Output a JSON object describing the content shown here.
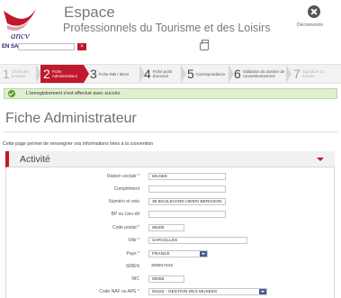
{
  "header": {
    "logo_text": "ancv",
    "brand_main": "Espace",
    "brand_sub": "Professionnels du Tourisme et des Loisirs",
    "logout_label": "Déconnexion",
    "saisie_label": "EN SAISIE",
    "saisie_clear": "×"
  },
  "steps": [
    {
      "num": "1",
      "label": "Choix des produits"
    },
    {
      "num": "2",
      "label": "Fiche Administrateur"
    },
    {
      "num": "3",
      "label": "Fiche RIB / IBAN"
    },
    {
      "num": "4",
      "label": "Fiche point d'accueil"
    },
    {
      "num": "5",
      "label": "Correspondance"
    },
    {
      "num": "6",
      "label": "Validation du dossier de conventionnement"
    },
    {
      "num": "7",
      "label": "Signature du dossier"
    }
  ],
  "success_message": "L'enregistrement s'est effectué avec succès.",
  "page_title": "Fiche Administrateur",
  "intro": "Cette page permet de renseigner vos informations liées à la convention",
  "section": {
    "title": "Activité",
    "fields": [
      {
        "label": "Raison sociale",
        "required": "*",
        "value": "MUSEE"
      },
      {
        "label": "Complément",
        "required": "",
        "value": ""
      },
      {
        "label": "Numéro et voie",
        "required": "",
        "value": "36 BOULEVARD HENRI BERGSON"
      },
      {
        "label": "BP ou Lieu-dit",
        "required": "",
        "value": ""
      },
      {
        "label": "Code postal",
        "required": "*",
        "value": "95200"
      },
      {
        "label": "Ville",
        "required": "*",
        "value": "SARCELLES"
      },
      {
        "label": "Pays",
        "required": "*",
        "value": "FRANCE"
      },
      {
        "label": "SIREN",
        "required": "",
        "value": "325817442"
      },
      {
        "label": "NIC",
        "required": "",
        "value": "00055"
      },
      {
        "label": "Code NAF ou APE",
        "required": "*",
        "value": "9102Z - GESTION DES MUSEES"
      }
    ]
  }
}
